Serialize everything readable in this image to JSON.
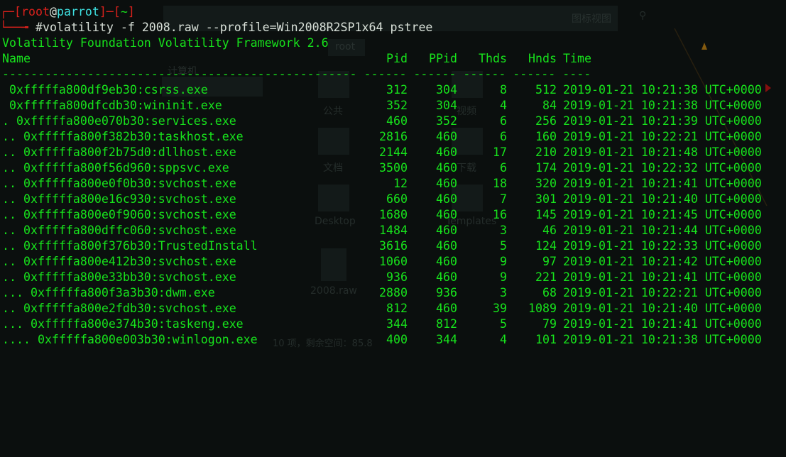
{
  "prompt": {
    "user": "root",
    "host": "parrot",
    "dir": "~",
    "hash": "#",
    "command": "volatility -f 2008.raw --profile=Win2008R2SP1x64 pstree"
  },
  "banner": "Volatility Foundation Volatility Framework 2.6",
  "columns": {
    "name": "Name",
    "pid": "Pid",
    "ppid": "PPid",
    "thds": "Thds",
    "hnds": "Hnds",
    "time": "Time"
  },
  "separator": "-------------------------------------------------- ------ ------ ------ ------ ----",
  "rows": [
    {
      "name": " 0xfffffa800df9eb30:csrss.exe",
      "pid": "312",
      "ppid": "304",
      "thds": "8",
      "hnds": "512",
      "time": "2019-01-21 10:21:38 UTC+0000"
    },
    {
      "name": " 0xfffffa800dfcdb30:wininit.exe",
      "pid": "352",
      "ppid": "304",
      "thds": "4",
      "hnds": "84",
      "time": "2019-01-21 10:21:38 UTC+0000"
    },
    {
      "name": ". 0xfffffa800e070b30:services.exe",
      "pid": "460",
      "ppid": "352",
      "thds": "6",
      "hnds": "256",
      "time": "2019-01-21 10:21:39 UTC+0000"
    },
    {
      "name": ".. 0xfffffa800f382b30:taskhost.exe",
      "pid": "2816",
      "ppid": "460",
      "thds": "6",
      "hnds": "160",
      "time": "2019-01-21 10:22:21 UTC+0000"
    },
    {
      "name": ".. 0xfffffa800f2b75d0:dllhost.exe",
      "pid": "2144",
      "ppid": "460",
      "thds": "17",
      "hnds": "210",
      "time": "2019-01-21 10:21:48 UTC+0000"
    },
    {
      "name": ".. 0xfffffa800f56d960:sppsvc.exe",
      "pid": "3500",
      "ppid": "460",
      "thds": "6",
      "hnds": "174",
      "time": "2019-01-21 10:22:32 UTC+0000"
    },
    {
      "name": ".. 0xfffffa800e0f0b30:svchost.exe",
      "pid": "12",
      "ppid": "460",
      "thds": "18",
      "hnds": "320",
      "time": "2019-01-21 10:21:41 UTC+0000"
    },
    {
      "name": ".. 0xfffffa800e16c930:svchost.exe",
      "pid": "660",
      "ppid": "460",
      "thds": "7",
      "hnds": "301",
      "time": "2019-01-21 10:21:40 UTC+0000"
    },
    {
      "name": ".. 0xfffffa800e0f9060:svchost.exe",
      "pid": "1680",
      "ppid": "460",
      "thds": "16",
      "hnds": "145",
      "time": "2019-01-21 10:21:45 UTC+0000"
    },
    {
      "name": ".. 0xfffffa800dffc060:svchost.exe",
      "pid": "1484",
      "ppid": "460",
      "thds": "3",
      "hnds": "46",
      "time": "2019-01-21 10:21:44 UTC+0000"
    },
    {
      "name": ".. 0xfffffa800f376b30:TrustedInstall",
      "pid": "3616",
      "ppid": "460",
      "thds": "5",
      "hnds": "124",
      "time": "2019-01-21 10:22:33 UTC+0000"
    },
    {
      "name": ".. 0xfffffa800e412b30:svchost.exe",
      "pid": "1060",
      "ppid": "460",
      "thds": "9",
      "hnds": "97",
      "time": "2019-01-21 10:21:42 UTC+0000"
    },
    {
      "name": ".. 0xfffffa800e33bb30:svchost.exe",
      "pid": "936",
      "ppid": "460",
      "thds": "9",
      "hnds": "221",
      "time": "2019-01-21 10:21:41 UTC+0000"
    },
    {
      "name": "... 0xfffffa800f3a3b30:dwm.exe",
      "pid": "2880",
      "ppid": "936",
      "thds": "3",
      "hnds": "68",
      "time": "2019-01-21 10:22:21 UTC+0000"
    },
    {
      "name": ".. 0xfffffa800e2fdb30:svchost.exe",
      "pid": "812",
      "ppid": "460",
      "thds": "39",
      "hnds": "1089",
      "time": "2019-01-21 10:21:40 UTC+0000"
    },
    {
      "name": "... 0xfffffa800e374b30:taskeng.exe",
      "pid": "344",
      "ppid": "812",
      "thds": "5",
      "hnds": "79",
      "time": "2019-01-21 10:21:41 UTC+0000"
    },
    {
      "name": ".... 0xfffffa800e003b30:winlogon.exe",
      "pid": "400",
      "ppid": "344",
      "thds": "4",
      "hnds": "101",
      "time": "2019-01-21 10:21:38 UTC+0000"
    }
  ],
  "background": {
    "sidebar_items": [
      "计算机",
      "公共",
      "文档",
      "Desktop"
    ],
    "folder_items": [
      "视频",
      "下载",
      "Templates"
    ],
    "file_name": "2008.raw",
    "status_bar": "10 项，剩余空间：85.8",
    "path_chip": "root",
    "view_label": "图标视图"
  }
}
